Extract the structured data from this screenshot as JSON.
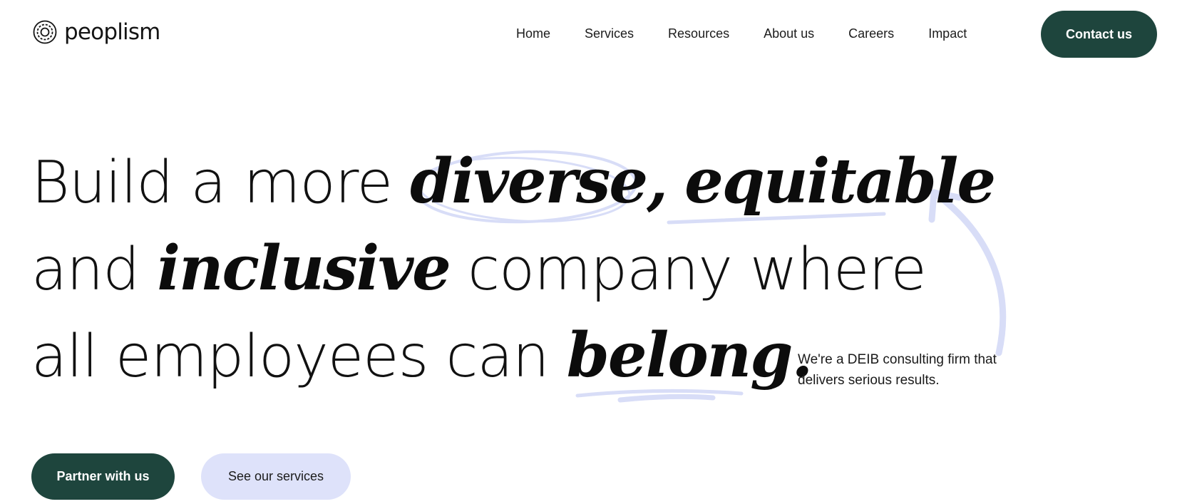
{
  "brand": {
    "name": "peoplism",
    "logo_icon": "concentric-circles-logo-icon"
  },
  "nav": {
    "items": [
      {
        "label": "Home"
      },
      {
        "label": "Services"
      },
      {
        "label": "Resources"
      },
      {
        "label": "About us"
      },
      {
        "label": "Careers"
      },
      {
        "label": "Impact"
      }
    ],
    "cta_label": "Contact us"
  },
  "hero": {
    "line1": {
      "pre": "Build a more ",
      "script1": "diverse,",
      "script2": "equitable"
    },
    "line2": {
      "pre": "and ",
      "script": "inclusive",
      "post": " company where"
    },
    "line3": {
      "pre": "all employees can ",
      "script": "belong."
    },
    "tagline": "We're a DEIB consulting firm that delivers serious results.",
    "primary_cta": "Partner with us",
    "secondary_cta": "See our services"
  },
  "colors": {
    "primary": "#1e453d",
    "accent_light": "#dee2fa",
    "doodle": "#d8ddf7",
    "text": "#141414",
    "background": "#ffffff"
  }
}
